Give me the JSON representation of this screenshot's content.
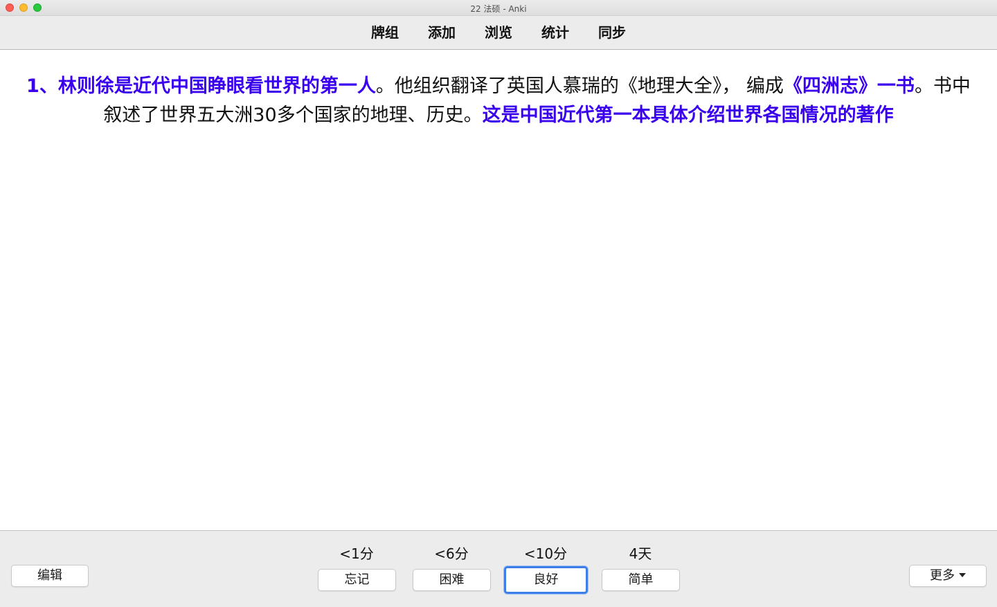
{
  "window": {
    "title": "22 法硕 - Anki"
  },
  "toolbar": {
    "items": [
      "牌组",
      "添加",
      "浏览",
      "统计",
      "同步"
    ]
  },
  "card": {
    "segments": [
      {
        "text": "1、林则徐是近代中国睁眼看世界的第一人",
        "highlight": true
      },
      {
        "text": "。他组织翻译了英国人慕瑞的《地理大全》， 编成",
        "highlight": false
      },
      {
        "text": "《四洲志》一书",
        "highlight": true
      },
      {
        "text": "。书中叙述了世界五大洲30多个国家的地理、历史。",
        "highlight": false
      },
      {
        "text": "这是中国近代第一本具体介绍世界各国情况的著作",
        "highlight": true
      }
    ],
    "highlight_color": "#3a00ee"
  },
  "bottom": {
    "edit_label": "编辑",
    "more_label": "更多",
    "answers": [
      {
        "interval": "<1分",
        "label": "忘记",
        "focused": false
      },
      {
        "interval": "<6分",
        "label": "困难",
        "focused": false
      },
      {
        "interval": "<10分",
        "label": "良好",
        "focused": true
      },
      {
        "interval": "4天",
        "label": "简单",
        "focused": false
      }
    ]
  }
}
